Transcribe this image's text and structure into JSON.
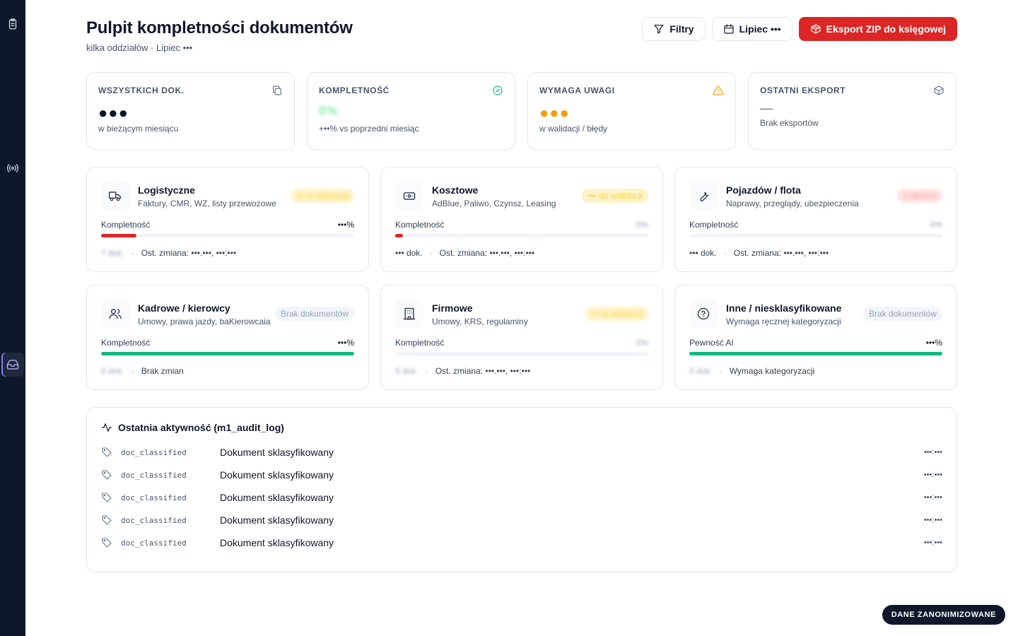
{
  "sidebar": {
    "items": [
      "clipboard-icon",
      "broadcast-icon",
      "inbox-icon"
    ],
    "active": "inbox-icon"
  },
  "header": {
    "title": "Pulpit kompletności dokumentów",
    "subtitle": "kilka oddziałów · Lipiec •••",
    "filters_label": "Filtry",
    "month_label": "Lipiec •••",
    "export_label": "Eksport ZIP do księgowej"
  },
  "colors": {
    "accent_red": "#dc2626",
    "green": "#10b981",
    "orange": "#f59e0b",
    "sidebar": "#0f172a"
  },
  "kpis": [
    {
      "label": "WSZYSTKICH DOK.",
      "value": "●●●",
      "note": "w bieżącym miesiącu",
      "icon": "copy-icon"
    },
    {
      "label": "KOMPLETNOŚĆ",
      "value": "0%",
      "note": "+••% vs poprzedni miesiąc",
      "icon": "check-circle-icon"
    },
    {
      "label": "WYMAGA UWAGI",
      "value": "●●●",
      "note": "w walidacji / błędy",
      "icon": "warning-icon"
    },
    {
      "label": "OSTATNI EKSPORT",
      "value": "—",
      "note": "Brak eksportów",
      "icon": "package-icon"
    }
  ],
  "categories": [
    {
      "title": "Logistyczne",
      "desc": "Faktury, CMR, WZ, listy przewozowe",
      "badge": "••• w walidacji",
      "progress_label": "Kompletność",
      "progress_value": "•••%",
      "progress": 0.14,
      "bar_color": "#dc2626",
      "count": "7 dok.",
      "last_change": "Ost. zmiana: •••.•••, •••:•••",
      "icon": "truck-icon"
    },
    {
      "title": "Kosztowe",
      "desc": "AdBlue, Paliwo, Czynsz, Leasing",
      "badge": "••• do walidacji",
      "progress_label": "Kompletność",
      "progress_value": "0%",
      "progress": 0.03,
      "bar_color": "#dc2626",
      "count": "••• dok.",
      "last_change": "Ost. zmiana: •••.•••, •••:•••",
      "icon": "banknote-icon"
    },
    {
      "title": "Pojazdów / flota",
      "desc": "Naprawy, przeglądy, ubezpieczenia",
      "badge": "1 błędów",
      "progress_label": "Kompletność",
      "progress_value": "0%",
      "progress": 0,
      "bar_color": "#dc2626",
      "count": "••• dok.",
      "last_change": "Ost. zmiana: •••.•••, •••:•••",
      "icon": "wrench-icon"
    },
    {
      "title": "Kadrowe / kierowcy",
      "desc": "Umowy, prawa jazdy, baKierowcaia",
      "badge": "Brak dokumentów",
      "progress_label": "Kompletność",
      "progress_value": "•••%",
      "progress": 1,
      "bar_color": "#10b981",
      "count": "0 dok.",
      "last_change": "Brak zmian",
      "icon": "users-icon"
    },
    {
      "title": "Firmowe",
      "desc": "Umowy, KRS, regulaminy",
      "badge": "••• w walidacji",
      "progress_label": "Kompletność",
      "progress_value": "0%",
      "progress": 0,
      "bar_color": "#dc2626",
      "count": "0 dok.",
      "last_change": "Ost. zmiana: •••.•••, •••:•••",
      "icon": "building-icon"
    },
    {
      "title": "Inne / niesklasyfikowane",
      "desc": "Wymaga ręcznej kategoryzacji",
      "badge": "Brak dokumentów",
      "progress_label": "Pewność AI",
      "progress_value": "•••%",
      "progress": 1,
      "bar_color": "#10b981",
      "count": "0 dok.",
      "last_change": "Wymaga kategoryzacji",
      "icon": "question-icon"
    }
  ],
  "activity": {
    "title": "Ostatnia aktywność (m1_audit_log)",
    "rows": [
      {
        "code": "doc_classified",
        "text": "Dokument sklasyfikowany",
        "time": "•••:•••"
      },
      {
        "code": "doc_classified",
        "text": "Dokument sklasyfikowany",
        "time": "•••:•••"
      },
      {
        "code": "doc_classified",
        "text": "Dokument sklasyfikowany",
        "time": "•••:•••"
      },
      {
        "code": "doc_classified",
        "text": "Dokument sklasyfikowany",
        "time": "•••:•••"
      },
      {
        "code": "doc_classified",
        "text": "Dokument sklasyfikowany",
        "time": "•••:•••"
      }
    ]
  },
  "anon_badge": "DANE ZANONIMIZOWANE"
}
